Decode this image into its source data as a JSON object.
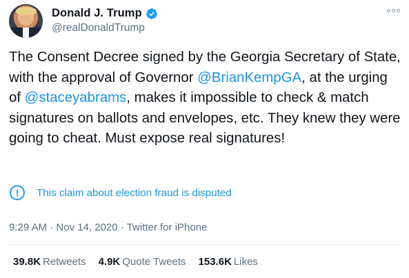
{
  "author": {
    "display_name": "Donald J. Trump",
    "handle": "@realDonaldTrump",
    "verified": true,
    "avatar_icon": "profile-photo"
  },
  "tweet": {
    "segments": [
      {
        "text": "The Consent Decree signed by the Georgia Secretary of State, with the approval of Governor ",
        "type": "text"
      },
      {
        "text": "@BrianKempGA",
        "type": "mention"
      },
      {
        "text": ", at the urging of ",
        "type": "text"
      },
      {
        "text": "@staceyabrams",
        "type": "mention"
      },
      {
        "text": ", makes it impossible to check & match signatures on ballots and envelopes, etc. They knew they were going to cheat. Must expose real signatures!",
        "type": "text"
      }
    ]
  },
  "notice": {
    "icon": "exclamation-circle-icon",
    "text": "This claim about election fraud is disputed"
  },
  "meta": {
    "time": "9:29 AM",
    "date": "Nov 14, 2020",
    "source": "Twitter for iPhone",
    "separator": " · "
  },
  "stats": [
    {
      "count": "39.8K",
      "label": "Retweets"
    },
    {
      "count": "4.9K",
      "label": "Quote Tweets"
    },
    {
      "count": "153.6K",
      "label": "Likes"
    }
  ],
  "colors": {
    "link": "#1b95e0",
    "secondary_text": "#5b7083",
    "primary_text": "#0f1419",
    "verified": "#1d9bf0"
  }
}
